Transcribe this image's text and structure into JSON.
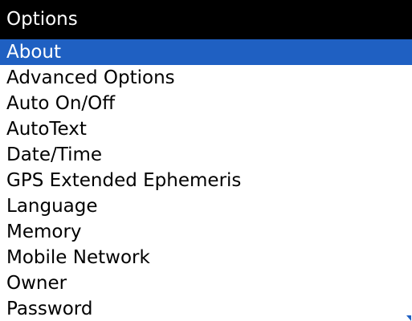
{
  "header": {
    "title": "Options"
  },
  "menu": {
    "selected_index": 0,
    "items": [
      {
        "label": "About"
      },
      {
        "label": "Advanced Options"
      },
      {
        "label": "Auto On/Off"
      },
      {
        "label": "AutoText"
      },
      {
        "label": "Date/Time"
      },
      {
        "label": "GPS Extended Ephemeris"
      },
      {
        "label": "Language"
      },
      {
        "label": "Memory"
      },
      {
        "label": "Mobile Network"
      },
      {
        "label": "Owner"
      },
      {
        "label": "Password"
      }
    ]
  },
  "colors": {
    "highlight": "#1f60c2",
    "title_bar": "#000000"
  },
  "icons": {
    "scroll_indicator": "scroll-down-arrow-icon"
  }
}
